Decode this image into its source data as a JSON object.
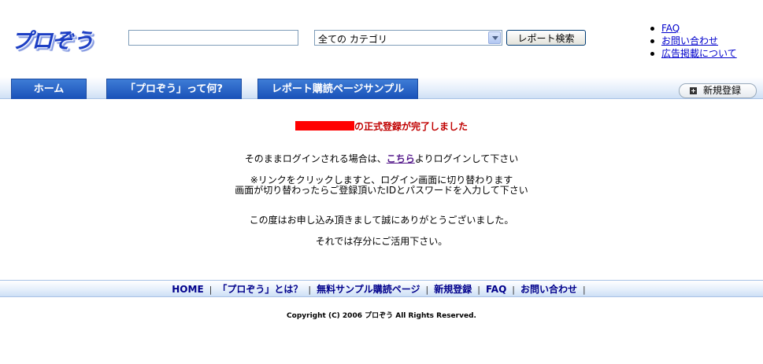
{
  "header": {
    "logo_text": "プロぞう",
    "search": {
      "value": ""
    },
    "category": {
      "selected": "全ての カテゴリ"
    },
    "search_button": "レポート検索",
    "links": [
      "FAQ",
      "お問い合わせ",
      "広告掲載について"
    ]
  },
  "nav": {
    "tabs": [
      "ホーム",
      "「プロぞう」って何?",
      "レポート購読ページサンプル"
    ],
    "register": "新規登録"
  },
  "main": {
    "completed": "の正式登録が完了しました",
    "login_prefix": "そのままログインされる場合は、",
    "login_link": "こちら",
    "login_suffix": "よりログインして下さい",
    "note1": "※リンクをクリックしますと、ログイン画面に切り替わります",
    "note2": "画面が切り替わったらご登録頂いたIDとパスワードを入力して下さい",
    "thanks": "この度はお申し込み頂きまして誠にありがとうございました。",
    "closing": "それでは存分にご活用下さい。"
  },
  "footer": {
    "links": [
      "HOME",
      "「プロぞう」とは？",
      "無料サンプル購読ページ",
      "新規登録",
      "FAQ",
      "お問い合わせ"
    ],
    "copyright": "Copyright (C) 2006 プロぞう All Rights Reserved."
  }
}
